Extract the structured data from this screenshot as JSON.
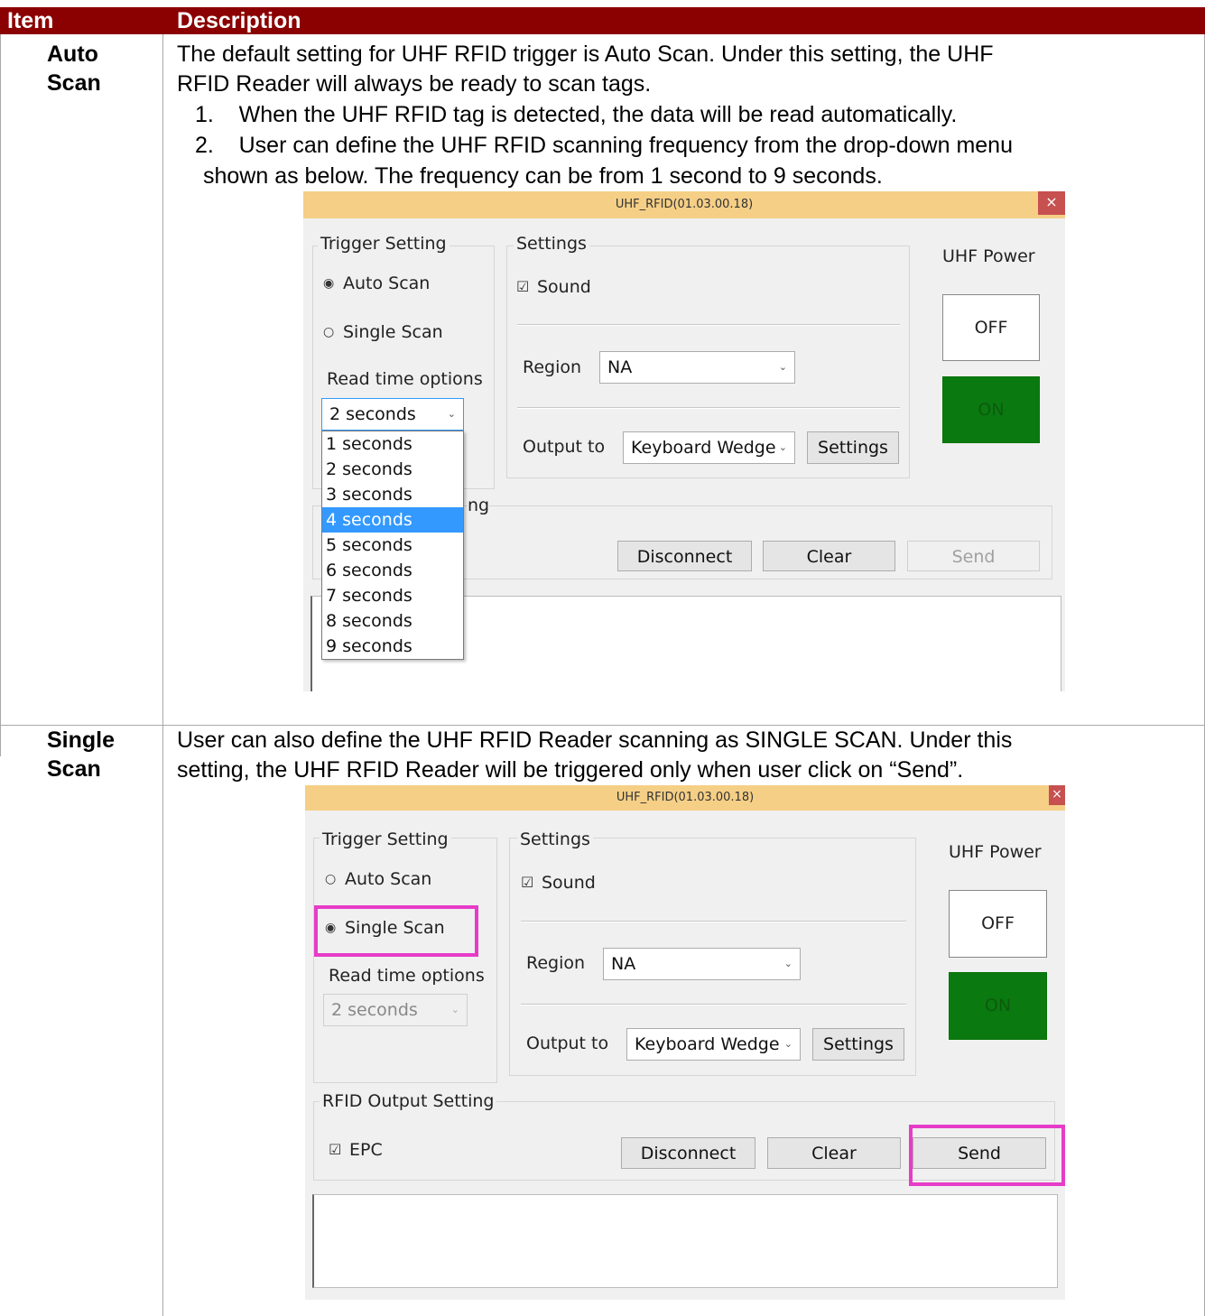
{
  "table": {
    "headers": {
      "item": "Item",
      "description": "Description"
    }
  },
  "rows": [
    {
      "item_line1": "Auto",
      "item_line2": "Scan",
      "lines": [
        "The default setting for UHF RFID trigger is Auto Scan. Under this setting, the UHF",
        "RFID Reader will always be ready to scan tags.",
        "1.    When the UHF RFID tag is detected, the data will be read automatically.",
        "2.    User can define the UHF RFID scanning frequency from the drop-down menu",
        "shown as below. The frequency can be from 1 second to 9 seconds."
      ]
    },
    {
      "item_line1": "Single",
      "item_line2": "Scan",
      "lines": [
        "User can also define the UHF RFID Reader scanning as SINGLE SCAN. Under this",
        "setting, the UHF RFID Reader will be triggered only when user click on “Send”."
      ]
    }
  ],
  "dialog1": {
    "title": "UHF_RFID(01.03.00.18)",
    "close_glyph": "×",
    "trigger_setting": "Trigger Setting",
    "auto_scan": "Auto Scan",
    "single_scan": "Single Scan",
    "read_time_options": "Read time options",
    "read_time_value": "2 seconds",
    "settings_group": "Settings",
    "sound": "Sound",
    "region_label": "Region",
    "region_value": "NA",
    "output_to": "Output to",
    "output_value": "Keyboard Wedge",
    "settings_button": "Settings",
    "uhf_power": "UHF Power",
    "off": "OFF",
    "on": "ON",
    "output_group_partial": "ng",
    "disconnect": "Disconnect",
    "clear": "Clear",
    "send": "Send",
    "dropdown_options": [
      "1 seconds",
      "2 seconds",
      "3 seconds",
      "4 seconds",
      "5 seconds",
      "6 seconds",
      "7 seconds",
      "8 seconds",
      "9 seconds"
    ],
    "dropdown_selected": "4 seconds"
  },
  "dialog2": {
    "title": "UHF_RFID(01.03.00.18)",
    "close_glyph": "×",
    "trigger_setting": "Trigger Setting",
    "auto_scan": "Auto Scan",
    "single_scan": "Single Scan",
    "read_time_options": "Read time options",
    "read_time_value": "2 seconds",
    "settings_group": "Settings",
    "sound": "Sound",
    "region_label": "Region",
    "region_value": "NA",
    "output_to": "Output to",
    "output_value": "Keyboard Wedge",
    "settings_button": "Settings",
    "uhf_power": "UHF Power",
    "off": "OFF",
    "on": "ON",
    "rfid_output_setting": "RFID Output Setting",
    "epc": "EPC",
    "disconnect": "Disconnect",
    "clear": "Clear",
    "send": "Send"
  },
  "colors": {
    "header_bg": "#8b0000",
    "titlebar": "#f5cf86",
    "on_green": "#0a7a10",
    "highlight": "#e63cc8",
    "selection": "#3399ff"
  }
}
